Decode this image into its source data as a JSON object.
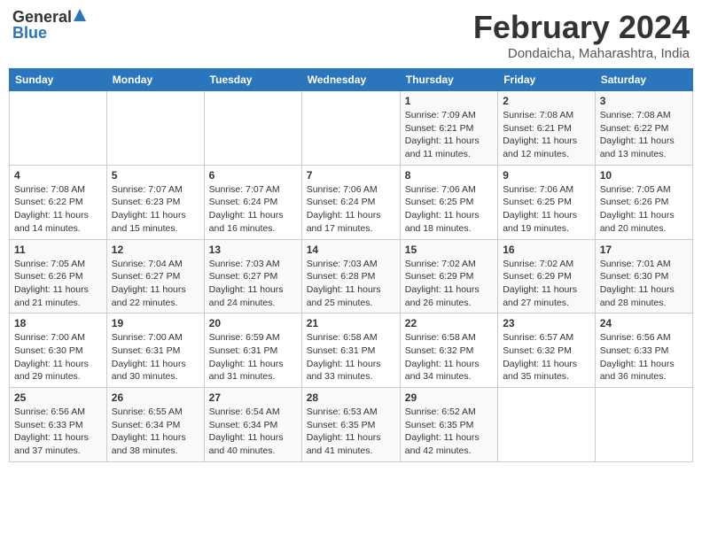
{
  "header": {
    "logo_general": "General",
    "logo_blue": "Blue",
    "title": "February 2024",
    "location": "Dondaicha, Maharashtra, India"
  },
  "days_of_week": [
    "Sunday",
    "Monday",
    "Tuesday",
    "Wednesday",
    "Thursday",
    "Friday",
    "Saturday"
  ],
  "weeks": [
    [
      {
        "day": "",
        "info": ""
      },
      {
        "day": "",
        "info": ""
      },
      {
        "day": "",
        "info": ""
      },
      {
        "day": "",
        "info": ""
      },
      {
        "day": "1",
        "info": "Sunrise: 7:09 AM\nSunset: 6:21 PM\nDaylight: 11 hours and 11 minutes."
      },
      {
        "day": "2",
        "info": "Sunrise: 7:08 AM\nSunset: 6:21 PM\nDaylight: 11 hours and 12 minutes."
      },
      {
        "day": "3",
        "info": "Sunrise: 7:08 AM\nSunset: 6:22 PM\nDaylight: 11 hours and 13 minutes."
      }
    ],
    [
      {
        "day": "4",
        "info": "Sunrise: 7:08 AM\nSunset: 6:22 PM\nDaylight: 11 hours and 14 minutes."
      },
      {
        "day": "5",
        "info": "Sunrise: 7:07 AM\nSunset: 6:23 PM\nDaylight: 11 hours and 15 minutes."
      },
      {
        "day": "6",
        "info": "Sunrise: 7:07 AM\nSunset: 6:24 PM\nDaylight: 11 hours and 16 minutes."
      },
      {
        "day": "7",
        "info": "Sunrise: 7:06 AM\nSunset: 6:24 PM\nDaylight: 11 hours and 17 minutes."
      },
      {
        "day": "8",
        "info": "Sunrise: 7:06 AM\nSunset: 6:25 PM\nDaylight: 11 hours and 18 minutes."
      },
      {
        "day": "9",
        "info": "Sunrise: 7:06 AM\nSunset: 6:25 PM\nDaylight: 11 hours and 19 minutes."
      },
      {
        "day": "10",
        "info": "Sunrise: 7:05 AM\nSunset: 6:26 PM\nDaylight: 11 hours and 20 minutes."
      }
    ],
    [
      {
        "day": "11",
        "info": "Sunrise: 7:05 AM\nSunset: 6:26 PM\nDaylight: 11 hours and 21 minutes."
      },
      {
        "day": "12",
        "info": "Sunrise: 7:04 AM\nSunset: 6:27 PM\nDaylight: 11 hours and 22 minutes."
      },
      {
        "day": "13",
        "info": "Sunrise: 7:03 AM\nSunset: 6:27 PM\nDaylight: 11 hours and 24 minutes."
      },
      {
        "day": "14",
        "info": "Sunrise: 7:03 AM\nSunset: 6:28 PM\nDaylight: 11 hours and 25 minutes."
      },
      {
        "day": "15",
        "info": "Sunrise: 7:02 AM\nSunset: 6:29 PM\nDaylight: 11 hours and 26 minutes."
      },
      {
        "day": "16",
        "info": "Sunrise: 7:02 AM\nSunset: 6:29 PM\nDaylight: 11 hours and 27 minutes."
      },
      {
        "day": "17",
        "info": "Sunrise: 7:01 AM\nSunset: 6:30 PM\nDaylight: 11 hours and 28 minutes."
      }
    ],
    [
      {
        "day": "18",
        "info": "Sunrise: 7:00 AM\nSunset: 6:30 PM\nDaylight: 11 hours and 29 minutes."
      },
      {
        "day": "19",
        "info": "Sunrise: 7:00 AM\nSunset: 6:31 PM\nDaylight: 11 hours and 30 minutes."
      },
      {
        "day": "20",
        "info": "Sunrise: 6:59 AM\nSunset: 6:31 PM\nDaylight: 11 hours and 31 minutes."
      },
      {
        "day": "21",
        "info": "Sunrise: 6:58 AM\nSunset: 6:31 PM\nDaylight: 11 hours and 33 minutes."
      },
      {
        "day": "22",
        "info": "Sunrise: 6:58 AM\nSunset: 6:32 PM\nDaylight: 11 hours and 34 minutes."
      },
      {
        "day": "23",
        "info": "Sunrise: 6:57 AM\nSunset: 6:32 PM\nDaylight: 11 hours and 35 minutes."
      },
      {
        "day": "24",
        "info": "Sunrise: 6:56 AM\nSunset: 6:33 PM\nDaylight: 11 hours and 36 minutes."
      }
    ],
    [
      {
        "day": "25",
        "info": "Sunrise: 6:56 AM\nSunset: 6:33 PM\nDaylight: 11 hours and 37 minutes."
      },
      {
        "day": "26",
        "info": "Sunrise: 6:55 AM\nSunset: 6:34 PM\nDaylight: 11 hours and 38 minutes."
      },
      {
        "day": "27",
        "info": "Sunrise: 6:54 AM\nSunset: 6:34 PM\nDaylight: 11 hours and 40 minutes."
      },
      {
        "day": "28",
        "info": "Sunrise: 6:53 AM\nSunset: 6:35 PM\nDaylight: 11 hours and 41 minutes."
      },
      {
        "day": "29",
        "info": "Sunrise: 6:52 AM\nSunset: 6:35 PM\nDaylight: 11 hours and 42 minutes."
      },
      {
        "day": "",
        "info": ""
      },
      {
        "day": "",
        "info": ""
      }
    ]
  ]
}
